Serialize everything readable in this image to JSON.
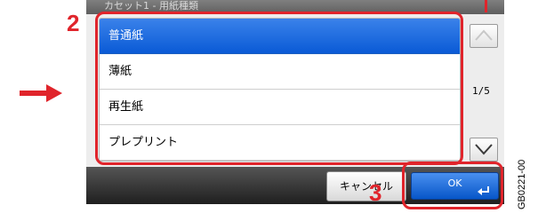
{
  "screen": {
    "title": "カセット1 - 用紙種類",
    "list": {
      "items": [
        {
          "label": "普通紙",
          "selected": true
        },
        {
          "label": "薄紙",
          "selected": false
        },
        {
          "label": "再生紙",
          "selected": false
        },
        {
          "label": "プレプリント",
          "selected": false
        }
      ]
    },
    "pager": {
      "page_indicator": "1/5"
    },
    "footer": {
      "cancel_label": "キャンセル",
      "ok_label": "OK"
    }
  },
  "annotations": {
    "callout_2": "2",
    "callout_3": "3",
    "highlight_color": "#e0242b",
    "figure_id": "GB0221-00"
  },
  "colors": {
    "selected_row": "#0a5ad6",
    "ok_button": "#0756c8"
  },
  "icons": [
    "chevron-up-icon",
    "chevron-down-icon",
    "enter-icon",
    "right-arrow-icon"
  ]
}
